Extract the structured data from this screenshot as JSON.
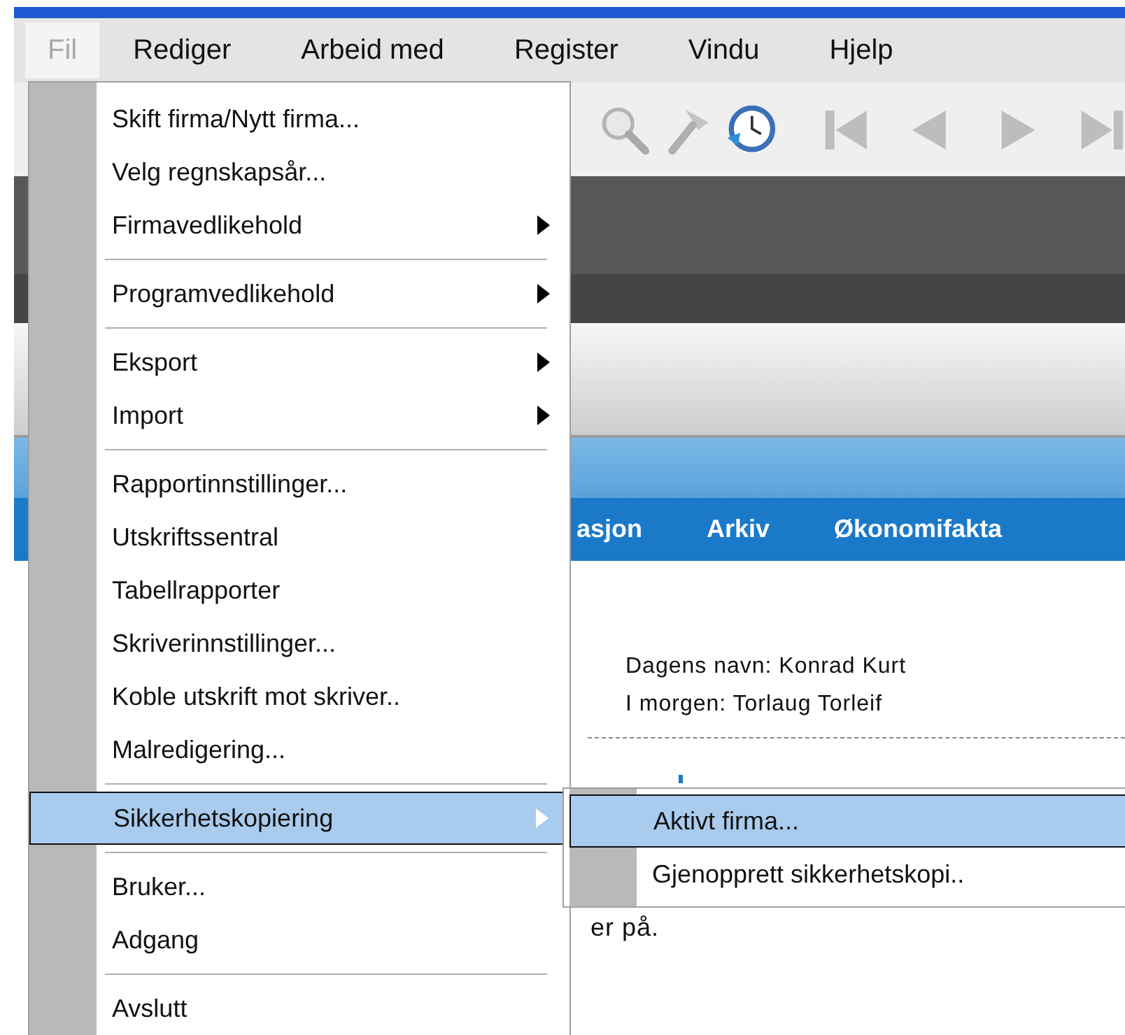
{
  "menubar": [
    {
      "label": "Fil",
      "selected": true
    },
    {
      "label": "Rediger",
      "selected": false
    },
    {
      "label": "Arbeid med",
      "selected": false
    },
    {
      "label": "Register",
      "selected": false
    },
    {
      "label": "Vindu",
      "selected": false
    },
    {
      "label": "Hjelp",
      "selected": false
    }
  ],
  "tabs": [
    {
      "label": "asjon"
    },
    {
      "label": "Arkiv"
    },
    {
      "label": "Økonomifakta"
    }
  ],
  "info": {
    "name_day": "Dagens navn: Konrad Kurt",
    "tomorrow": "I morgen: Torlaug Torleif"
  },
  "body_text": "er på.",
  "menu": {
    "groups": [
      [
        {
          "label": "Skift firma/Nytt firma...",
          "submenu": false,
          "selected": false
        },
        {
          "label": "Velg regnskapsår...",
          "submenu": false,
          "selected": false
        },
        {
          "label": "Firmavedlikehold",
          "submenu": true,
          "selected": false
        }
      ],
      [
        {
          "label": "Programvedlikehold",
          "submenu": true,
          "selected": false
        }
      ],
      [
        {
          "label": "Eksport",
          "submenu": true,
          "selected": false
        },
        {
          "label": "Import",
          "submenu": true,
          "selected": false
        }
      ],
      [
        {
          "label": "Rapportinnstillinger...",
          "submenu": false,
          "selected": false
        },
        {
          "label": "Utskriftssentral",
          "submenu": false,
          "selected": false
        },
        {
          "label": "Tabellrapporter",
          "submenu": false,
          "selected": false
        },
        {
          "label": "Skriverinnstillinger...",
          "submenu": false,
          "selected": false
        },
        {
          "label": "Koble utskrift mot skriver..",
          "submenu": false,
          "selected": false
        },
        {
          "label": "Malredigering...",
          "submenu": false,
          "selected": false
        }
      ],
      [
        {
          "label": "Sikkerhetskopiering",
          "submenu": true,
          "selected": true
        }
      ],
      [
        {
          "label": "Bruker...",
          "submenu": false,
          "selected": false
        },
        {
          "label": "Adgang",
          "submenu": false,
          "selected": false
        }
      ],
      [
        {
          "label": "Avslutt",
          "submenu": false,
          "selected": false
        }
      ]
    ]
  },
  "submenu": {
    "items": [
      {
        "label": "Aktivt firma...",
        "selected": true
      },
      {
        "label": "Gjenopprett sikkerhetskopi..",
        "selected": false
      }
    ]
  }
}
